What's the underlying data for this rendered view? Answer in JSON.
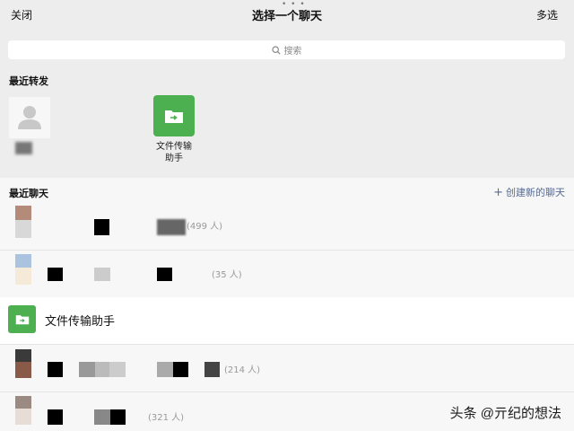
{
  "topbar": {
    "close_label": "关闭",
    "title": "选择一个聊天",
    "multi_select_label": "多选"
  },
  "search": {
    "placeholder": "搜索"
  },
  "recent_forward": {
    "section_title": "最近转发",
    "items": [
      {
        "label": ""
      },
      {
        "label_line1": "文件传输",
        "label_line2": "助手"
      }
    ]
  },
  "recent_chats": {
    "section_title": "最近聊天",
    "create_new_label": "创建新的聊天",
    "rows": [
      {
        "count": "(499 人)"
      },
      {
        "count": "(35 人)"
      },
      {
        "name": "文件传输助手"
      },
      {
        "count": "(214 人)"
      },
      {
        "count": "(321 人)"
      }
    ]
  },
  "watermark": "头条 @亓纪的想法",
  "colors": {
    "accent_green": "#4caf50",
    "link_blue": "#576b95"
  }
}
